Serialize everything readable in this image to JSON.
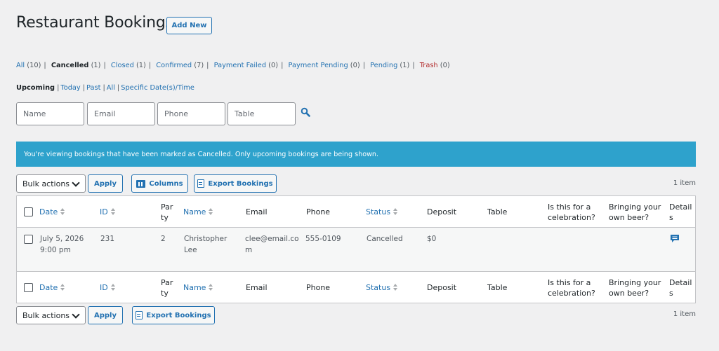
{
  "page": {
    "title": "Restaurant Bookings",
    "add_new_label": "Add New"
  },
  "status_links": [
    {
      "label": "All",
      "count": "(10)",
      "current": false
    },
    {
      "label": "Cancelled",
      "count": "(1)",
      "current": true
    },
    {
      "label": "Closed",
      "count": "(1)",
      "current": false
    },
    {
      "label": "Confirmed",
      "count": "(7)",
      "current": false
    },
    {
      "label": "Payment Failed",
      "count": "(0)",
      "current": false
    },
    {
      "label": "Payment Pending",
      "count": "(0)",
      "current": false
    },
    {
      "label": "Pending",
      "count": "(1)",
      "current": false
    },
    {
      "label": "Trash",
      "count": "(0)",
      "current": false
    }
  ],
  "date_links": [
    {
      "label": "Upcoming",
      "current": true
    },
    {
      "label": "Today",
      "current": false
    },
    {
      "label": "Past",
      "current": false
    },
    {
      "label": "All",
      "current": false
    },
    {
      "label": "Specific Date(s)/Time",
      "current": false
    }
  ],
  "filters": {
    "name_placeholder": "Name",
    "email_placeholder": "Email",
    "phone_placeholder": "Phone",
    "table_placeholder": "Table",
    "search_icon": "search-icon"
  },
  "notice": "You're viewing bookings that have been marked as Cancelled. Only upcoming bookings are being shown.",
  "toolbar_top": {
    "bulk_actions": "Bulk actions",
    "apply": "Apply",
    "columns": "Columns",
    "export": "Export Bookings",
    "items_count": "1 item"
  },
  "toolbar_bottom": {
    "bulk_actions": "Bulk actions",
    "apply": "Apply",
    "export": "Export Bookings",
    "items_count": "1 item"
  },
  "columns": {
    "date": "Date",
    "id": "ID",
    "party_line1": "Par",
    "party_line2": "ty",
    "name": "Name",
    "email": "Email",
    "phone": "Phone",
    "status": "Status",
    "deposit": "Deposit",
    "table": "Table",
    "celebration_line1": "Is this for a",
    "celebration_line2": "celebration?",
    "beer_line1": "Bringing your",
    "beer_line2": "own beer?",
    "details_line1": "Detail",
    "details_line2": "s"
  },
  "rows": [
    {
      "date_line1": "July 5, 2026",
      "date_line2": "9:00 pm",
      "id": "231",
      "party": "2",
      "name_line1": "Christopher",
      "name_line2": "Lee",
      "email_line1": "clee@email.co",
      "email_line2": "m",
      "phone": "555-0109",
      "status": "Cancelled",
      "deposit": "$0",
      "table": "",
      "celebration": "",
      "beer": "",
      "details_icon": "comment-icon"
    }
  ],
  "colors": {
    "link": "#2271b1",
    "notice_bg": "#2ea2cc",
    "trash": "#b32d2e",
    "page_bg": "#f0f0f1"
  }
}
